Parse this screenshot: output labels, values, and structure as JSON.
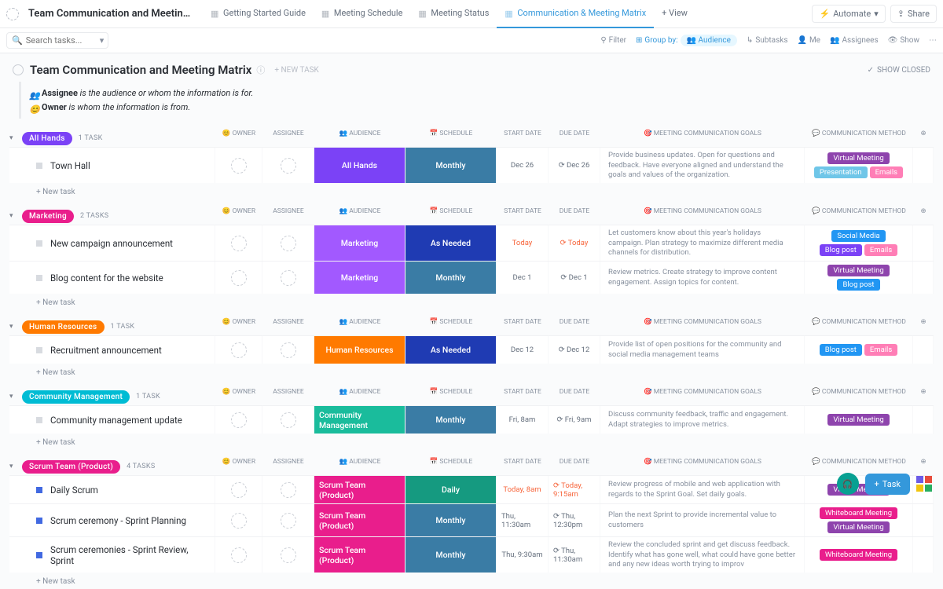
{
  "header": {
    "title": "Team Communication and Meeting Ma...",
    "tabs": [
      {
        "label": "Getting Started Guide",
        "active": false
      },
      {
        "label": "Meeting Schedule",
        "active": false
      },
      {
        "label": "Meeting Status",
        "active": false
      },
      {
        "label": "Communication & Meeting Matrix",
        "active": true
      }
    ],
    "add_view": "+ View",
    "automate": "Automate",
    "share": "Share"
  },
  "toolbar": {
    "search_placeholder": "Search tasks...",
    "filter": "Filter",
    "group_by": "Group by:",
    "audience": "Audience",
    "subtasks": "Subtasks",
    "me": "Me",
    "assignees": "Assignees",
    "show": "Show"
  },
  "content": {
    "title": "Team Communication and Meeting Matrix",
    "new_task": "+ NEW TASK",
    "show_closed": "SHOW CLOSED",
    "desc_assignee_label": "Assignee",
    "desc_assignee_text": " is the audience or whom the information is for.",
    "desc_owner_label": "Owner",
    "desc_owner_text": " is whom the information is from."
  },
  "columns": {
    "owner": "OWNER",
    "assignee": "ASSIGNEE",
    "audience": "AUDIENCE",
    "schedule": "SCHEDULE",
    "start": "START DATE",
    "due": "DUE DATE",
    "goals": "MEETING COMMUNICATION GOALS",
    "method": "COMMUNICATION METHOD"
  },
  "new_task_row": "+ New task",
  "colors": {
    "audience": {
      "all_hands": "#7b42f6",
      "marketing": "#a259ff",
      "hr": "#ff7a00",
      "community": "#1abc9c",
      "scrum": "#e91e8c"
    },
    "schedule": {
      "monthly": "#3a7ca5",
      "as_needed": "#1f3bb3",
      "daily": "#159a80"
    },
    "tags": {
      "virtual": "#8e44ad",
      "presentation": "#6fc6e8",
      "emails": "#ff7eb6",
      "social": "#2196f3",
      "blogpost_a": "#7b42f6",
      "blogpost_b": "#2196f3",
      "whiteboard": "#e91e8c"
    },
    "badges": {
      "all_hands": "#7b42f6",
      "marketing": "#e91e8c",
      "hr": "#ff7a00",
      "community": "#00bcd4",
      "scrum": "#e91e8c"
    }
  },
  "groups": [
    {
      "id": "all_hands",
      "name": "All Hands",
      "count": "1 TASK",
      "badge_color": "all_hands",
      "rows": [
        {
          "name": "Town Hall",
          "audience": "All Hands",
          "aud_key": "all_hands",
          "schedule": "Monthly",
          "sch_key": "monthly",
          "start": "Dec 26",
          "due": "Dec 26",
          "goals": "Provide business updates. Open for questions and feedback. Have everyone aligned and understand the goals and values of the organization.",
          "tags": [
            {
              "t": "Virtual Meeting",
              "c": "virtual"
            },
            {
              "t": "Presentation",
              "c": "presentation"
            },
            {
              "t": "Emails",
              "c": "emails"
            }
          ]
        }
      ]
    },
    {
      "id": "marketing",
      "name": "Marketing",
      "count": "2 TASKS",
      "badge_color": "marketing",
      "rows": [
        {
          "name": "New campaign announcement",
          "audience": "Marketing",
          "aud_key": "marketing",
          "schedule": "As Needed",
          "sch_key": "as_needed",
          "start": "Today",
          "due": "Today",
          "today": true,
          "goals": "Let customers know about this year's holidays campaign. Plan strategy to maximize different media channels for distribution.",
          "tags": [
            {
              "t": "Social Media",
              "c": "social"
            },
            {
              "t": "Blog post",
              "c": "blogpost_a"
            },
            {
              "t": "Emails",
              "c": "emails"
            }
          ]
        },
        {
          "name": "Blog content for the website",
          "audience": "Marketing",
          "aud_key": "marketing",
          "schedule": "Monthly",
          "sch_key": "monthly",
          "start": "Dec 1",
          "due": "Dec 1",
          "goals": "Review metrics. Create strategy to improve content engagement. Assign topics for content.",
          "tags": [
            {
              "t": "Virtual Meeting",
              "c": "virtual"
            },
            {
              "t": "Blog post",
              "c": "blogpost_b"
            }
          ]
        }
      ]
    },
    {
      "id": "hr",
      "name": "Human Resources",
      "count": "1 TASK",
      "badge_color": "hr",
      "rows": [
        {
          "name": "Recruitment announcement",
          "audience": "Human Resources",
          "aud_key": "hr",
          "schedule": "As Needed",
          "sch_key": "as_needed",
          "start": "Dec 12",
          "due": "Dec 12",
          "goals": "Provide list of open positions for the community and social media management teams",
          "tags": [
            {
              "t": "Blog post",
              "c": "blogpost_b"
            },
            {
              "t": "Emails",
              "c": "emails"
            }
          ]
        }
      ]
    },
    {
      "id": "community",
      "name": "Community Management",
      "count": "1 TASK",
      "badge_color": "community",
      "rows": [
        {
          "name": "Community management update",
          "audience": "Community Management",
          "aud_key": "community",
          "schedule": "Monthly",
          "sch_key": "monthly",
          "start": "Fri, 8am",
          "due": "Fri, 9am",
          "goals": "Discuss community feedback, traffic and engagement. Adapt strategies to improve metrics.",
          "tags": [
            {
              "t": "Virtual Meeting",
              "c": "virtual"
            }
          ]
        }
      ]
    },
    {
      "id": "scrum",
      "name": "Scrum Team (Product)",
      "count": "4 TASKS",
      "badge_color": "scrum",
      "blue_bullets": true,
      "rows": [
        {
          "name": "Daily Scrum",
          "audience": "Scrum Team (Product)",
          "aud_key": "scrum",
          "schedule": "Daily",
          "sch_key": "daily",
          "start": "Today, 8am",
          "due": "Today, 9:15am",
          "today": true,
          "goals": "Review progress of mobile and web application with regards to the Sprint Goal. Set daily goals.",
          "tags": [
            {
              "t": "Virtual Meeting",
              "c": "virtual"
            }
          ]
        },
        {
          "name": "Scrum ceremony - Sprint Planning",
          "audience": "Scrum Team (Product)",
          "aud_key": "scrum",
          "schedule": "Monthly",
          "sch_key": "monthly",
          "start": "Thu, 11:30am",
          "due": "Thu, 12:30pm",
          "goals": "Plan the next Sprint to provide incremental value to customers",
          "tags": [
            {
              "t": "Whiteboard Meeting",
              "c": "whiteboard"
            },
            {
              "t": "Virtual Meeting",
              "c": "virtual"
            }
          ]
        },
        {
          "name": "Scrum ceremonies - Sprint Review, Sprint",
          "audience": "Scrum Team (Product)",
          "aud_key": "scrum",
          "schedule": "Monthly",
          "sch_key": "monthly",
          "start": "Thu, 9:30am",
          "due": "Thu, 11:30am",
          "goals": "Review the concluded sprint and get discuss feedback. Identify what has gone well, what could have gone better and any new ideas worth trying to improv",
          "tags": [
            {
              "t": "Whiteboard Meeting",
              "c": "whiteboard"
            }
          ]
        }
      ]
    }
  ]
}
